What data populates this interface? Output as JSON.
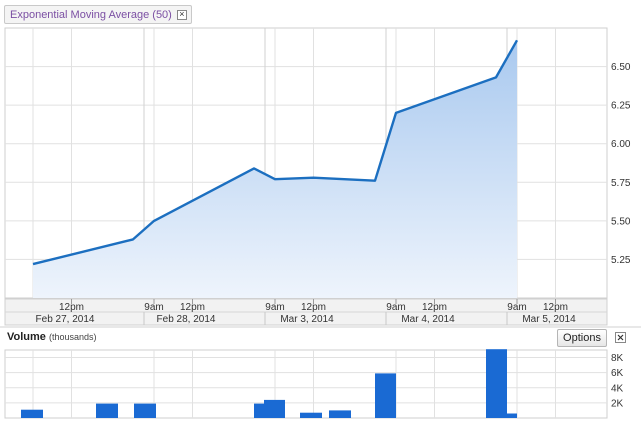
{
  "indicator": {
    "label": "Exponential Moving Average (50)",
    "close_icon": "close-icon"
  },
  "volume": {
    "title": "Volume",
    "unit": "(thousands)",
    "options_label": "Options",
    "close_icon": "close-icon"
  },
  "colors": {
    "line": "#1c6fc0",
    "fill_top": "#a9c9ef",
    "fill_bottom": "#eef4fc",
    "bar": "#1a6ad3",
    "grid": "#e1e1e1"
  },
  "chart_data": [
    {
      "type": "area",
      "title": "Exponential Moving Average (50)",
      "x_axis": {
        "time_labels": [
          "12pm",
          "9am",
          "12pm",
          "9am",
          "12pm",
          "9am",
          "12pm",
          "9am",
          "12pm"
        ],
        "date_labels": [
          "Feb 27, 2014",
          "Feb 28, 2014",
          "Mar 3, 2014",
          "Mar 4, 2014",
          "Mar 5, 2014"
        ]
      },
      "y_ticks": [
        "5.25",
        "5.50",
        "5.75",
        "6.00",
        "6.25",
        "6.50"
      ],
      "ylim": [
        5.0,
        6.75
      ],
      "grid": true,
      "series": [
        {
          "points": [
            [
              "Feb 27 09:30",
              5.22
            ],
            [
              "Feb 27 16:00",
              5.38
            ],
            [
              "Feb 28 09:30",
              5.5
            ],
            [
              "Feb 28 16:00",
              5.84
            ],
            [
              "Mar 3 09:30",
              5.77
            ],
            [
              "Mar 3 12:00",
              5.78
            ],
            [
              "Mar 3 16:00",
              5.76
            ],
            [
              "Mar 4 09:30",
              6.2
            ],
            [
              "Mar 4 16:00",
              6.43
            ],
            [
              "Mar 5 09:30",
              6.67
            ]
          ]
        }
      ]
    },
    {
      "type": "bar",
      "title": "Volume (thousands)",
      "y_ticks": [
        "2K",
        "4K",
        "6K",
        "8K"
      ],
      "ylim": [
        0,
        9
      ],
      "values": [
        1.1,
        1.9,
        1.9,
        1.9,
        2.4,
        0.7,
        1.0,
        5.9,
        9.1,
        0.6
      ]
    }
  ]
}
